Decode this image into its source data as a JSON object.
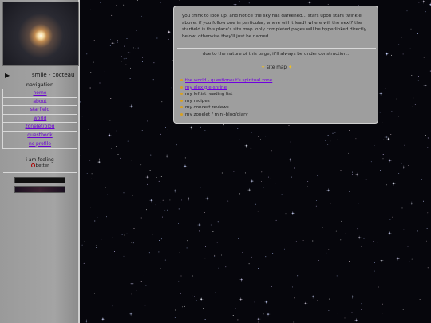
{
  "sidebar": {
    "now_playing": "smile - cocteau",
    "nav_heading": "navigation",
    "nav_items": [
      {
        "label": "home"
      },
      {
        "label": "about"
      },
      {
        "label": "starfield"
      },
      {
        "label": "world"
      },
      {
        "label": "zonelet/blog"
      },
      {
        "label": "guestbook"
      },
      {
        "label": "nc profile"
      }
    ],
    "feeling_label": "i am feeling",
    "feeling_value": "better"
  },
  "content": {
    "intro": "you think to look up, and notice the sky has darkened... stars upon stars twinkle above. if you follow one in particular, where will it lead? where will the next? the starfield is this place's site map. only completed pages will be hyperlinked directly below, otherwise they'll just be named.",
    "construction_note": "due to the nature of this page, it'll always be under construction...",
    "sitemap_heading": "site map",
    "sitemap": [
      {
        "label": "the world - questioneut's spiritual zone",
        "linked": true
      },
      {
        "label": "my alex g e-shrine",
        "linked": true
      },
      {
        "label": "my leftist reading list",
        "linked": false
      },
      {
        "label": "my recipes",
        "linked": false
      },
      {
        "label": "my concert reviews",
        "linked": false
      },
      {
        "label": "my zonelet / mini-blog/diary",
        "linked": false
      }
    ]
  },
  "icons": {
    "play": "play-icon",
    "feeling": "feeling-face-icon",
    "bullet": "star-bullet-icon"
  },
  "colors": {
    "page_background": "#06060c",
    "panel_background": "#9e9e9e",
    "sidebar_background": "#a4a4a4",
    "link": "#7000e0",
    "bullet": "#d8a020"
  }
}
